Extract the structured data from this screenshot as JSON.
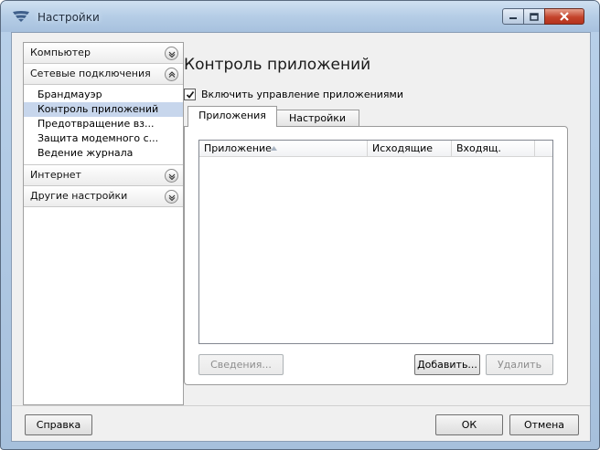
{
  "window": {
    "title": "Настройки",
    "icon": "app-wing-icon",
    "controls": [
      "minimize-icon",
      "maximize-icon",
      "close-icon"
    ],
    "colors": {
      "title_bar": "#b5cde6",
      "close_button": "#c4432b",
      "selection": "#c7d6ec"
    }
  },
  "sidebar": {
    "sections": [
      {
        "label": "Компьютер",
        "expanded": false,
        "icon": "chevron-down-icon"
      },
      {
        "label": "Сетевые подключения",
        "expanded": true,
        "icon": "chevron-up-icon",
        "items": [
          {
            "label": "Брандмауэр",
            "selected": false
          },
          {
            "label": "Контроль приложений",
            "selected": true
          },
          {
            "label": "Предотвращение вз...",
            "selected": false
          },
          {
            "label": "Защита модемного с...",
            "selected": false
          },
          {
            "label": "Ведение журнала",
            "selected": false
          }
        ]
      },
      {
        "label": "Интернет",
        "expanded": false,
        "icon": "chevron-down-icon"
      },
      {
        "label": "Другие настройки",
        "expanded": false,
        "icon": "chevron-down-icon"
      }
    ]
  },
  "main": {
    "title": "Контроль приложений",
    "enable_checkbox": {
      "label": "Включить управление приложениями",
      "checked": true
    },
    "tabs": [
      {
        "label": "Приложения",
        "active": true
      },
      {
        "label": "Настройки",
        "active": false
      }
    ],
    "table": {
      "columns": [
        "Приложение",
        "Исходящие",
        "Входящ."
      ],
      "sort_icon": "sort-ascending-icon",
      "rows": []
    },
    "buttons": {
      "details": "Сведения...",
      "add": "Добавить...",
      "remove": "Удалить"
    }
  },
  "footer": {
    "help": "Справка",
    "ok": "ОК",
    "cancel": "Отмена"
  }
}
